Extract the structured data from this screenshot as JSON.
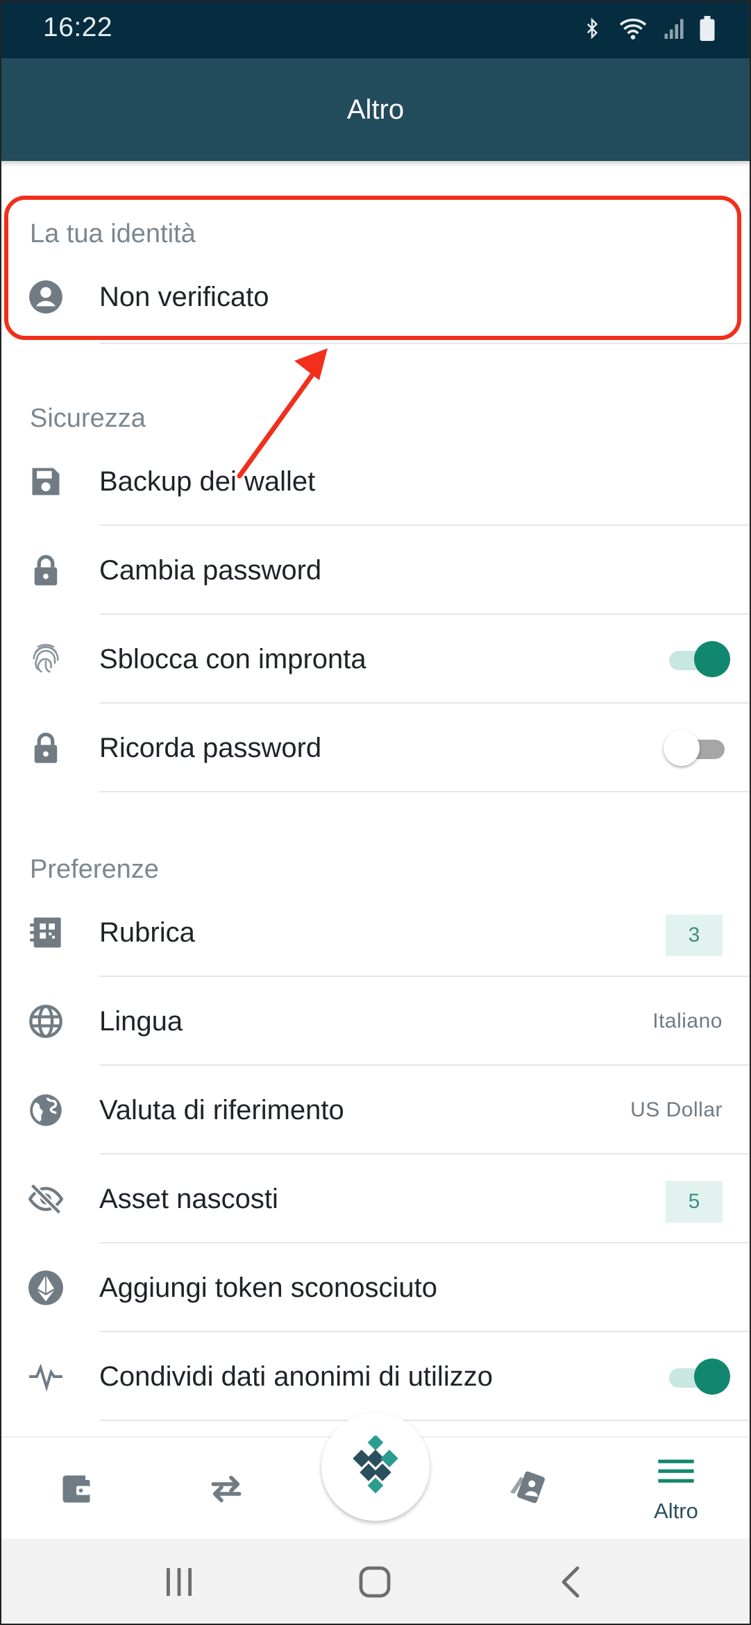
{
  "status_bar": {
    "time": "16:22",
    "icons": [
      "bluetooth-icon",
      "wifi-icon",
      "signal-icon",
      "battery-icon"
    ]
  },
  "app_bar": {
    "title": "Altro"
  },
  "identity": {
    "section_title": "La tua identità",
    "status_label": "Non verificato",
    "icon": "account-circle-icon"
  },
  "security": {
    "section_title": "Sicurezza",
    "items": [
      {
        "label": "Backup dei wallet",
        "icon": "save-icon"
      },
      {
        "label": "Cambia password",
        "icon": "lock-icon"
      },
      {
        "label": "Sblocca con impronta",
        "icon": "fingerprint-icon",
        "toggle": true
      },
      {
        "label": "Ricorda password",
        "icon": "lock-icon",
        "toggle": false
      }
    ]
  },
  "preferences": {
    "section_title": "Preferenze",
    "items": [
      {
        "label": "Rubrica",
        "icon": "address-book-icon",
        "badge": "3"
      },
      {
        "label": "Lingua",
        "icon": "globe-icon",
        "value": "Italiano"
      },
      {
        "label": "Valuta di riferimento",
        "icon": "earth-icon",
        "value": "US Dollar"
      },
      {
        "label": "Asset nascosti",
        "icon": "eye-off-icon",
        "badge": "5"
      },
      {
        "label": "Aggiungi token sconosciuto",
        "icon": "ethereum-icon"
      },
      {
        "label": "Condividi dati anonimi di utilizzo",
        "icon": "pulse-icon",
        "toggle": true
      }
    ]
  },
  "bottom_nav": {
    "items": [
      {
        "icon": "wallet-icon"
      },
      {
        "icon": "swap-icon"
      },
      {
        "icon": "app-logo-icon"
      },
      {
        "icon": "cards-icon"
      },
      {
        "icon": "menu-icon",
        "label": "Altro",
        "active": true
      }
    ]
  },
  "colors": {
    "status_bar": "#062d3f",
    "app_bar": "#224b5c",
    "accent": "#12876f",
    "highlight": "#f12f1c"
  }
}
